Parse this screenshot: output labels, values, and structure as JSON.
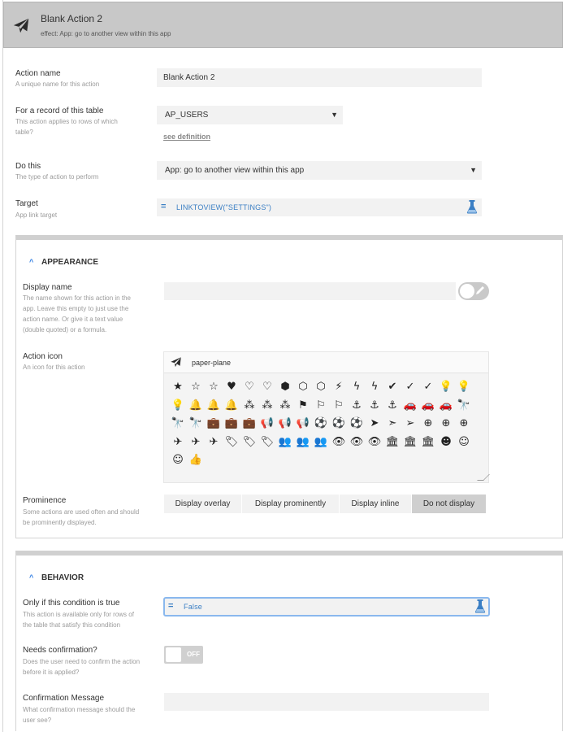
{
  "header": {
    "title": "Blank Action 2",
    "effect": "effect: App: go to another view within this app"
  },
  "action_name": {
    "label": "Action name",
    "hint": "A unique name for this action",
    "value": "Blank Action 2"
  },
  "table": {
    "label": "For a record of this table",
    "hint_1": "This action applies to rows of which",
    "hint_2": "table?",
    "value": "AP_USERS",
    "link": "see definition"
  },
  "do_this": {
    "label": "Do this",
    "hint": "The type of action to perform",
    "value": "App: go to another view within this app"
  },
  "target": {
    "label": "Target",
    "hint": "App link target",
    "eq": "=",
    "value": "LINKTOVIEW(\"SETTINGS\")"
  },
  "appearance": {
    "heading": "APPEARANCE",
    "chevron": "^",
    "display_name": {
      "label": "Display name",
      "hint_1": "The name shown for this action in the",
      "hint_2": "app. Leave this empty to just use the",
      "hint_3": "action name. Or give it a text value",
      "hint_4": "(double quoted) or a formula.",
      "value": ""
    },
    "action_icon": {
      "label": "Action icon",
      "hint": "An icon for this action",
      "search_value": "paper-plane",
      "icons": [
        "★",
        "☆",
        "☆",
        "♥",
        "♡",
        "♡",
        "⬢",
        "⬡",
        "⬡",
        "⚡",
        "ϟ",
        "ϟ",
        "✔",
        "✓",
        "✓",
        "💡",
        "💡",
        "💡",
        "🔔",
        "🔔",
        "🔔",
        "⁂",
        "⁂",
        "⁂",
        "⚑",
        "⚐",
        "⚐",
        "⚓",
        "⚓",
        "⚓",
        "🚗",
        "🚗",
        "🚗",
        "🔭",
        "🔭",
        "🔭",
        "💼",
        "💼",
        "💼",
        "📢",
        "📢",
        "📢",
        "⚽",
        "⚽",
        "⚽",
        "➤",
        "➣",
        "➢",
        "⊕",
        "⊕",
        "⊕",
        "✈",
        "✈",
        "✈",
        "🏷",
        "🏷",
        "🏷",
        "👥",
        "👥",
        "👥",
        "👁",
        "👁",
        "👁",
        "🏛",
        "🏛",
        "🏛",
        "☻",
        "☺",
        "☺",
        "👍"
      ]
    },
    "prominence": {
      "label": "Prominence",
      "hint_1": "Some actions are used often and should",
      "hint_2": "be prominently displayed.",
      "options": [
        "Display overlay",
        "Display prominently",
        "Display inline",
        "Do not display"
      ],
      "selected": "Do not display"
    }
  },
  "behavior": {
    "heading": "BEHAVIOR",
    "chevron": "^",
    "condition": {
      "label": "Only if this condition is true",
      "hint_1": "This action is available only for rows of",
      "hint_2": "the table that satisfy this condition",
      "eq": "=",
      "value": "False"
    },
    "confirmation": {
      "label": "Needs confirmation?",
      "hint_1": "Does the user need to confirm the action",
      "hint_2": "before it is applied?",
      "state": "OFF"
    },
    "confirmation_message": {
      "label": "Confirmation Message",
      "hint_1": "What confirmation message should the",
      "hint_2": "user see?",
      "value": ""
    }
  },
  "colors": {
    "header_bg": "#c8c8c8",
    "accent_blue": "#3b7fc4",
    "field_bg": "#f2f2f2",
    "selected_segment": "#cfcfcf"
  }
}
